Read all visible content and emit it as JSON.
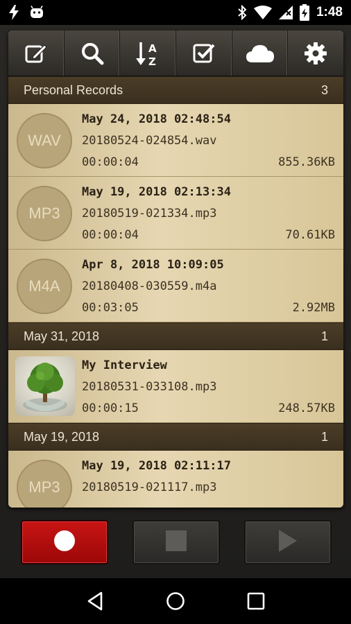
{
  "status_bar": {
    "time": "1:48",
    "icons": [
      "flash-icon",
      "android-icon",
      "bluetooth-icon",
      "wifi-icon",
      "signal-icon",
      "battery-icon"
    ]
  },
  "toolbar": {
    "buttons": [
      {
        "name": "edit-icon"
      },
      {
        "name": "search-icon"
      },
      {
        "name": "sort-az-icon"
      },
      {
        "name": "checkbox-icon"
      },
      {
        "name": "cloud-icon"
      },
      {
        "name": "settings-icon"
      }
    ]
  },
  "sections": [
    {
      "title": "Personal Records",
      "count": "3",
      "records": [
        {
          "format": "WAV",
          "title": "May 24, 2018 02:48:54",
          "file": "20180524-024854.wav",
          "duration": "00:00:04",
          "size": "855.36KB"
        },
        {
          "format": "MP3",
          "title": "May 19, 2018 02:13:34",
          "file": "20180519-021334.mp3",
          "duration": "00:00:04",
          "size": "70.61KB"
        },
        {
          "format": "M4A",
          "title": "Apr 8, 2018 10:09:05",
          "file": "20180408-030559.m4a",
          "duration": "00:03:05",
          "size": "2.92MB"
        }
      ]
    },
    {
      "title": "May 31, 2018",
      "count": "1",
      "records": [
        {
          "format": "",
          "title": "My Interview",
          "file": "20180531-033108.mp3",
          "duration": "00:00:15",
          "size": "248.57KB",
          "thumbnail": "tree-in-glass-image"
        }
      ]
    },
    {
      "title": "May 19, 2018",
      "count": "1",
      "records": [
        {
          "format": "MP3",
          "title": "May 19, 2018 02:11:17",
          "file": "20180519-021117.mp3",
          "duration": "",
          "size": ""
        }
      ]
    }
  ],
  "controls": {
    "record": "record-icon",
    "stop": "stop-icon",
    "play": "play-icon"
  },
  "colors": {
    "record_red": "#c81414",
    "header_brown": "#3a2f1e",
    "row_parchment": "#e6d7b2"
  }
}
